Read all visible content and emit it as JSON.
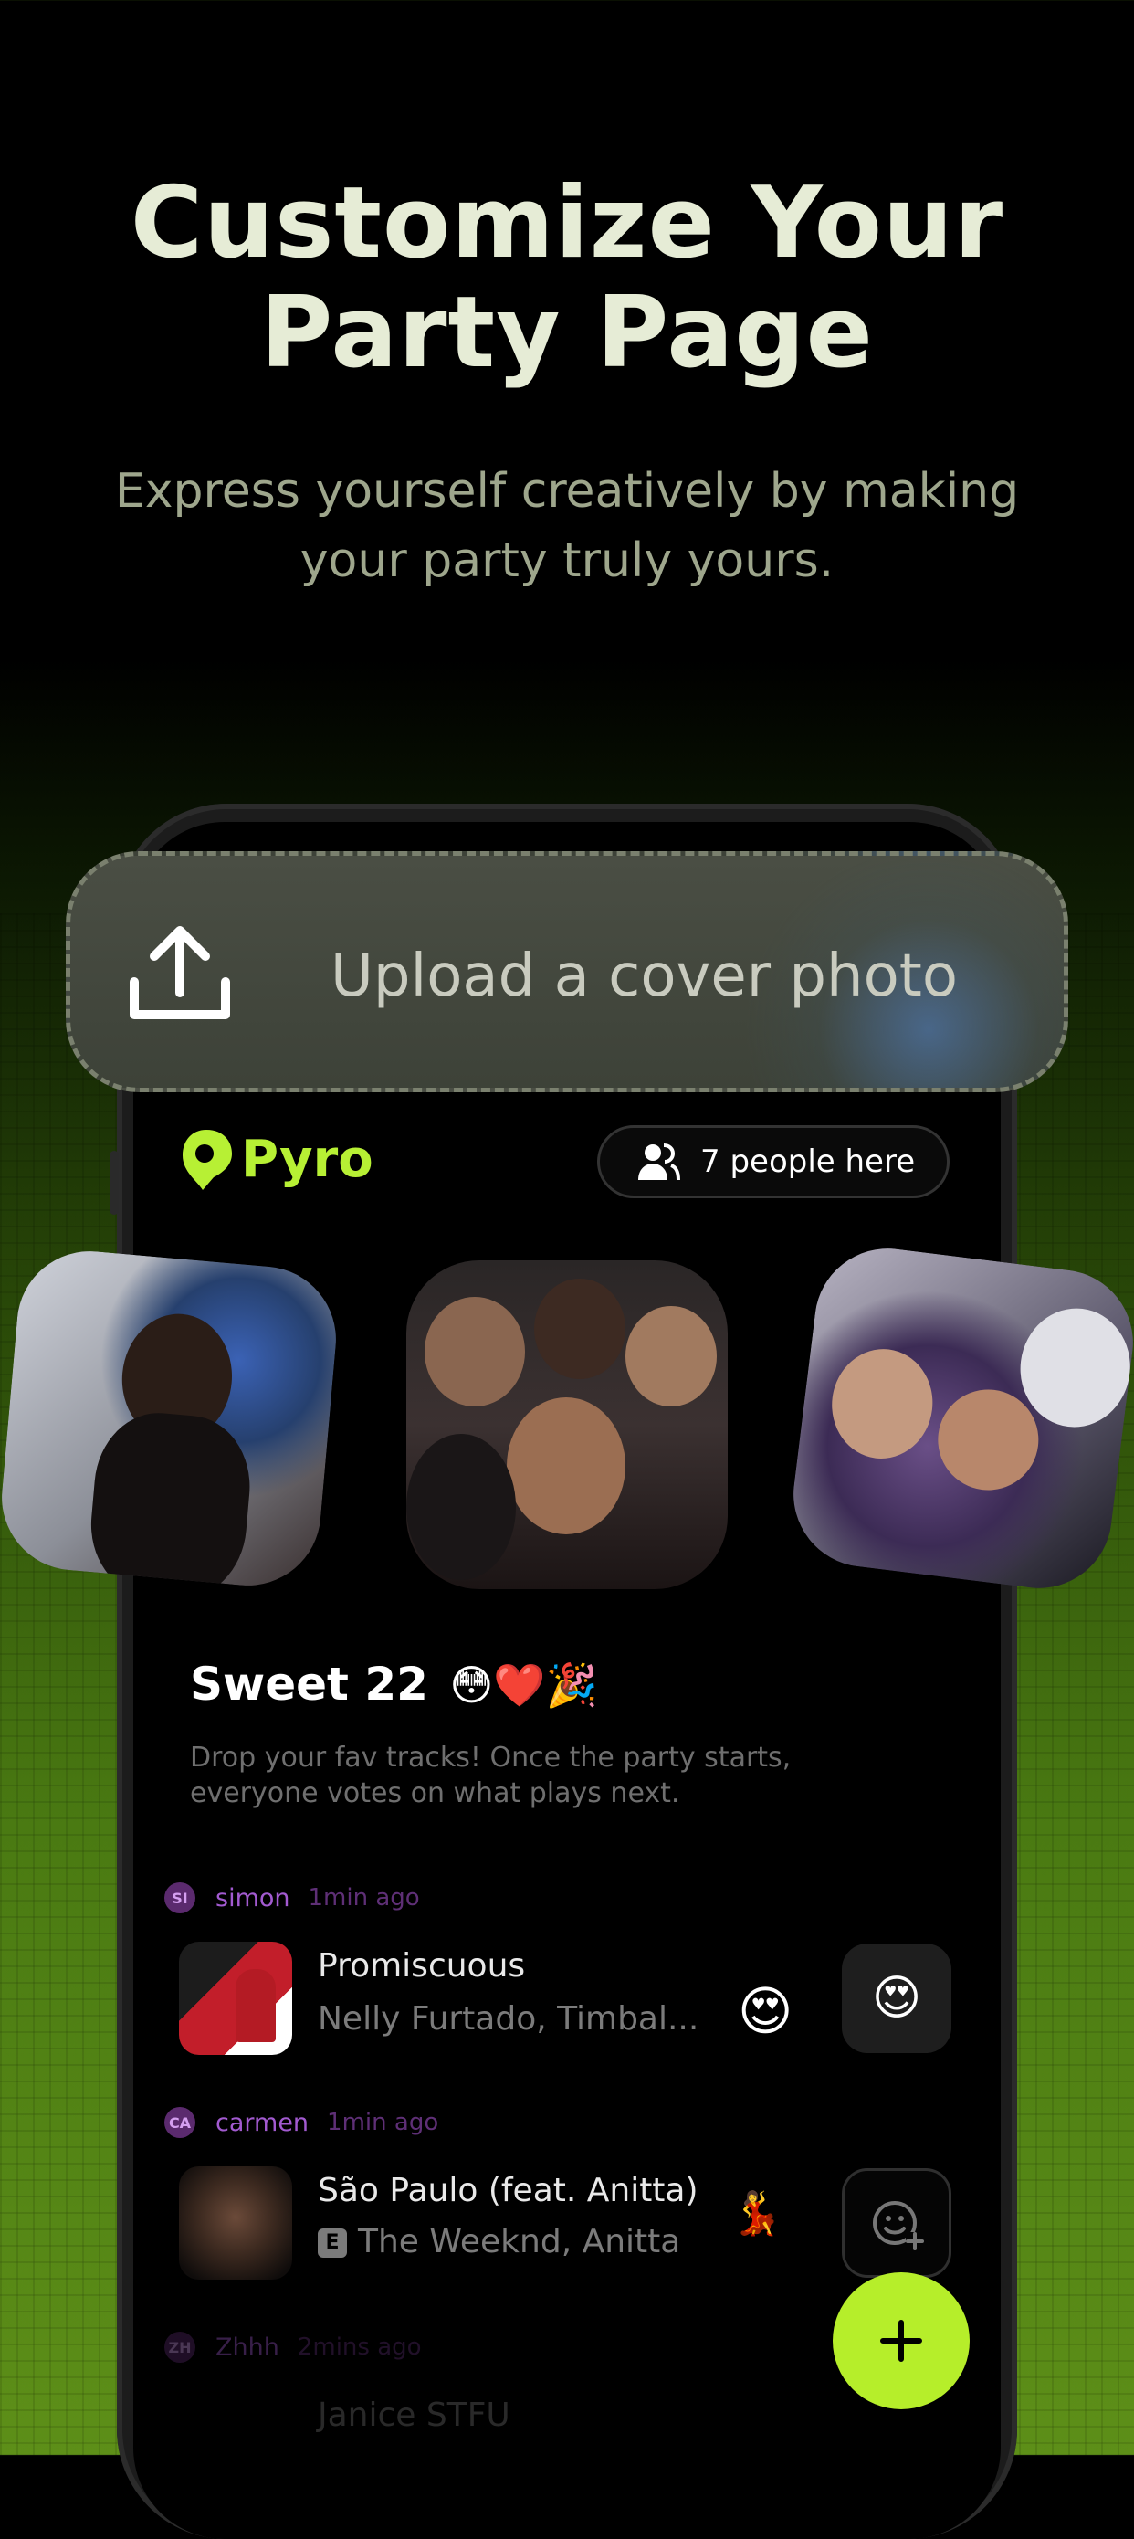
{
  "hero": {
    "title_line1": "Customize Your",
    "title_line2": "Party Page",
    "subtitle_line1": "Express yourself creatively by making",
    "subtitle_line2": "your party truly yours."
  },
  "upload": {
    "label": "Upload a cover photo",
    "icon": "upload-icon"
  },
  "app": {
    "logo_text": "Pyro",
    "brand_color": "#b7f034",
    "people_label": "7 people here"
  },
  "party": {
    "title": "Sweet 22",
    "title_emojis": "😳❤️🎉",
    "description": "Drop your fav tracks! Once the party starts, everyone votes on what plays next."
  },
  "songs": [
    {
      "user_initials": "SI",
      "user": "simon",
      "time": "1min ago",
      "title": "Promiscuous",
      "artist": "Nelly Furtado, Timbal...",
      "explicit": false,
      "reaction": "😍",
      "button_emoji": "😍"
    },
    {
      "user_initials": "CA",
      "user": "carmen",
      "time": "1min ago",
      "title": "São Paulo (feat. Anitta)",
      "artist": "The Weeknd, Anitta",
      "explicit": true,
      "explicit_label": "E",
      "reaction": "💃",
      "button_icon": "add-reaction-icon"
    },
    {
      "user_initials": "ZH",
      "user": "Zhhh",
      "time": "2mins ago",
      "title": "Janice STFU"
    }
  ],
  "fab": {
    "icon": "plus-icon"
  }
}
